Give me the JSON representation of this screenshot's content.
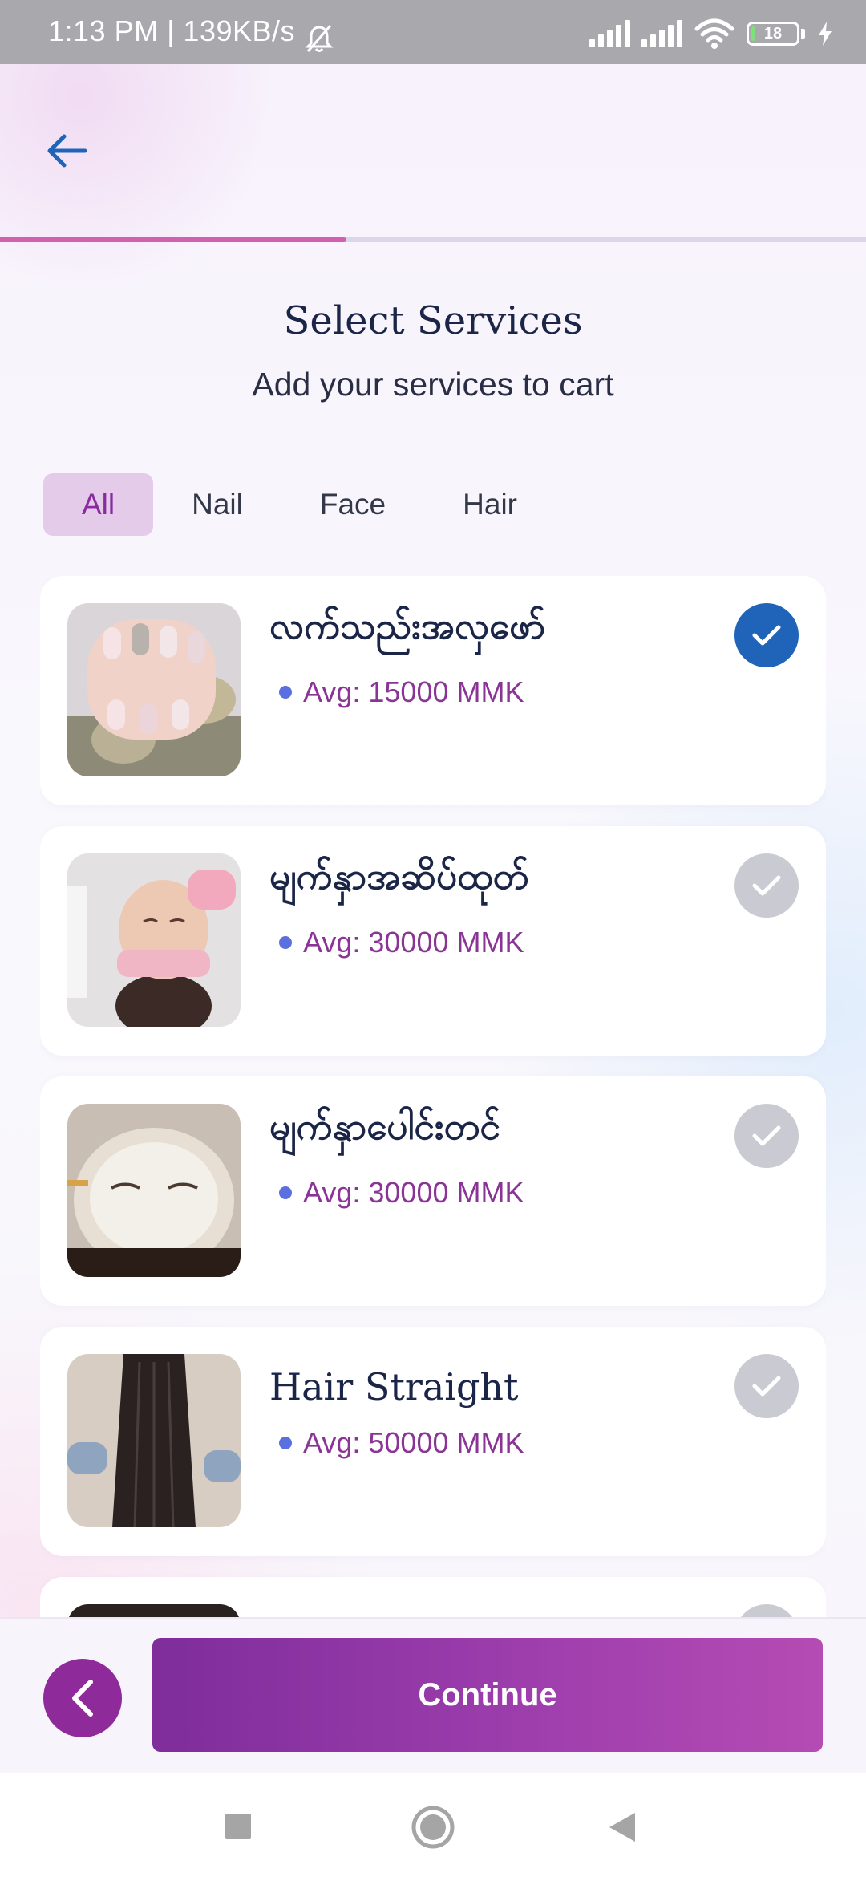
{
  "status_bar": {
    "time_speed": "1:13 PM | 139KB/s",
    "battery": "18"
  },
  "header": {
    "title": "Select Services",
    "subtitle": "Add your services to cart",
    "progress": 0.4
  },
  "tabs": [
    {
      "label": "All",
      "active": true
    },
    {
      "label": "Nail",
      "active": false
    },
    {
      "label": "Face",
      "active": false
    },
    {
      "label": "Hair",
      "active": false
    }
  ],
  "services": [
    {
      "name": "လက်သည်းအလှဖော်",
      "price": "Avg: 15000 MMK",
      "selected": true,
      "image": "nail-photo"
    },
    {
      "name": "မျက်နှာအဆိပ်ထုတ်",
      "price": "Avg: 30000 MMK",
      "selected": false,
      "image": "face-treatment-photo"
    },
    {
      "name": "မျက်နှာပေါင်းတင်",
      "price": "Avg: 30000 MMK",
      "selected": false,
      "image": "face-mask-photo"
    },
    {
      "name": "Hair Straight",
      "price": "Avg: 50000 MMK",
      "selected": false,
      "image": "hair-photo"
    }
  ],
  "footer": {
    "continue_label": "Continue"
  },
  "colors": {
    "accent": "#8e2a9a",
    "selected_check": "#1f64b8",
    "progress": "#d25fb0"
  }
}
